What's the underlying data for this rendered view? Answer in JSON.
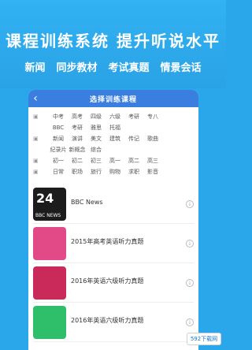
{
  "promo": {
    "headline": "课程训练系统 提升听说水平",
    "features": [
      "新闻",
      "同步教材",
      "考试真题",
      "情景会话"
    ]
  },
  "app": {
    "title": "选择训练课程",
    "filters": [
      {
        "head": "",
        "items": [
          "中考",
          "高考",
          "四级",
          "六级",
          "考研",
          "专八"
        ]
      },
      {
        "head": "",
        "items": [
          "BBC",
          "考研",
          "雅思",
          "托福"
        ]
      },
      {
        "head": "",
        "items": [
          "新闻",
          "演讲",
          "美文",
          "建筑",
          "传记",
          "歌曲"
        ]
      },
      {
        "head": "",
        "items": [
          "纪录片",
          "新概念",
          "综合"
        ]
      },
      {
        "head": "",
        "items": [
          "初一",
          "初二",
          "初三",
          "高一",
          "高二",
          "高三"
        ]
      },
      {
        "head": "",
        "items": [
          "日常",
          "职场",
          "旅行",
          "购物",
          "求职",
          "影音"
        ]
      }
    ],
    "list": [
      {
        "title": "BBC News",
        "sub": "",
        "thumb_big": "24",
        "thumb_small": "BBC NEWS",
        "theme": "bbc"
      },
      {
        "title": "2015年高考英语听力真题",
        "sub": "",
        "thumb_big": "",
        "thumb_small": "",
        "theme": "pink"
      },
      {
        "title": "2016年英语六级听力真题",
        "sub": "",
        "thumb_big": "",
        "thumb_small": "",
        "theme": "red"
      },
      {
        "title": "2016年英语六级听力真题",
        "sub": "",
        "thumb_big": "",
        "thumb_small": "",
        "theme": "green"
      }
    ]
  },
  "watermark": "592下载网"
}
